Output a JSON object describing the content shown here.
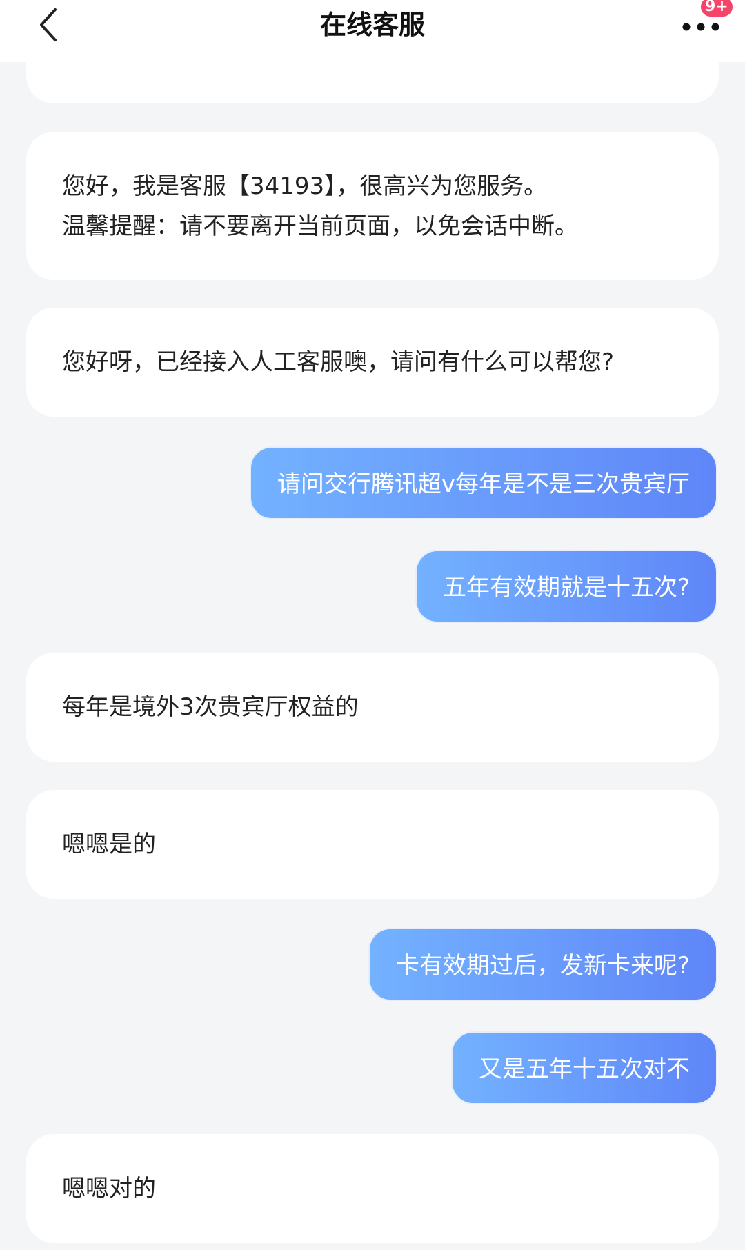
{
  "header": {
    "title": "在线客服",
    "badge": "9+"
  },
  "messages": [
    {
      "from": "agent",
      "lines": [
        "您好，我是客服【34193】，很高兴为您服务。",
        "温馨提醒：请不要离开当前页面，以免会话中断。"
      ]
    },
    {
      "from": "agent",
      "lines": [
        "您好呀，已经接入人工客服噢，请问有什么可以帮您?"
      ]
    },
    {
      "from": "user",
      "text": "请问交行腾讯超v每年是不是三次贵宾厅"
    },
    {
      "from": "user",
      "text": "五年有效期就是十五次?"
    },
    {
      "from": "agent",
      "lines": [
        "每年是境外3次贵宾厅权益的"
      ]
    },
    {
      "from": "agent",
      "lines": [
        "嗯嗯是的"
      ]
    },
    {
      "from": "user",
      "text": "卡有效期过后，发新卡来呢?"
    },
    {
      "from": "user",
      "text": "又是五年十五次对不"
    },
    {
      "from": "agent",
      "lines": [
        "嗯嗯对的"
      ]
    }
  ],
  "colors": {
    "user_bubble_start": "#73b2ff",
    "user_bubble_end": "#5f86f8",
    "badge": "#f5436a",
    "background": "#f4f5f7"
  }
}
